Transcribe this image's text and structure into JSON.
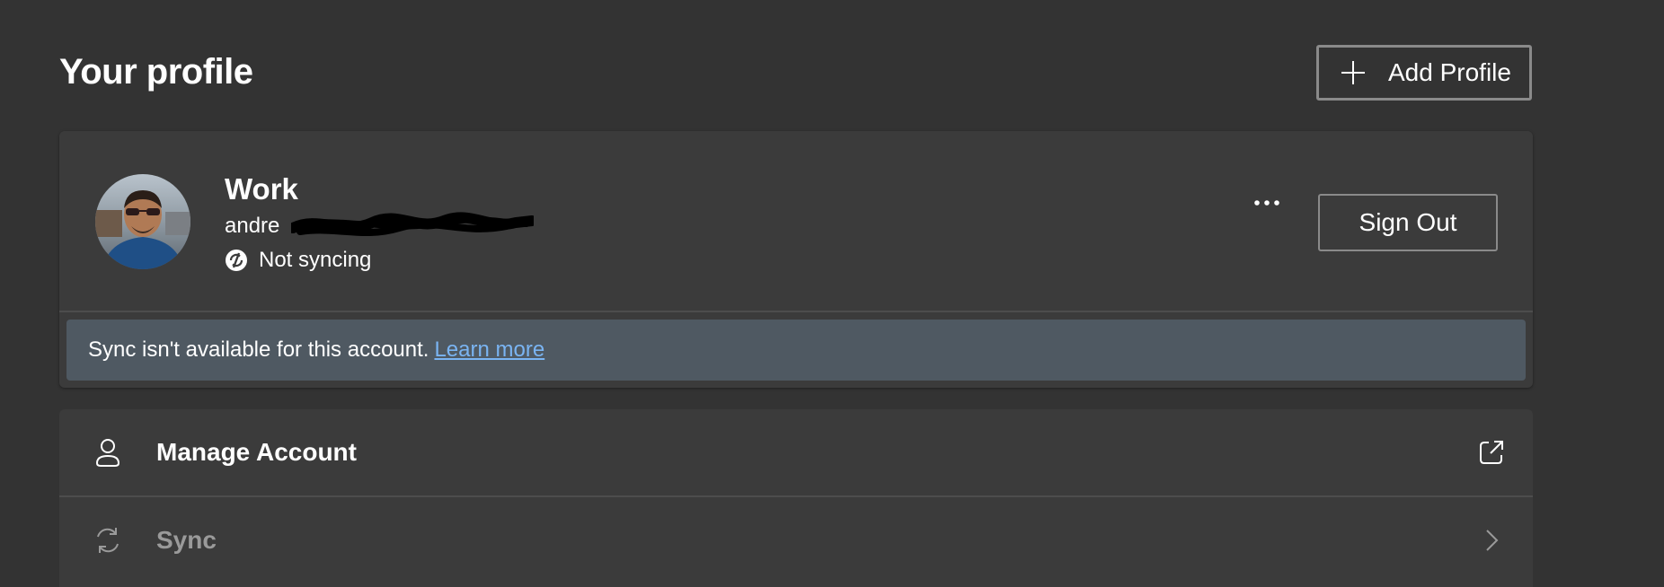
{
  "header": {
    "title": "Your profile",
    "add_profile_label": "Add Profile"
  },
  "profile": {
    "name": "Work",
    "email_visible": "andre",
    "sync_status": "Not syncing",
    "more_icon": "more-horizontal-icon",
    "sign_out_label": "Sign Out"
  },
  "banner": {
    "message": "Sync isn't available for this account.",
    "link_label": "Learn more",
    "background": "#4f5962",
    "link_color": "#7ab4f2"
  },
  "settings": {
    "items": [
      {
        "label": "Manage Account",
        "icon": "person-icon",
        "trailing_icon": "open-external-icon"
      },
      {
        "label": "Sync",
        "icon": "sync-icon",
        "trailing_icon": "chevron-right-icon",
        "disabled": true
      }
    ]
  },
  "colors": {
    "background": "#333333",
    "card": "#3b3b3b",
    "button_border": "#8a8a8a"
  }
}
